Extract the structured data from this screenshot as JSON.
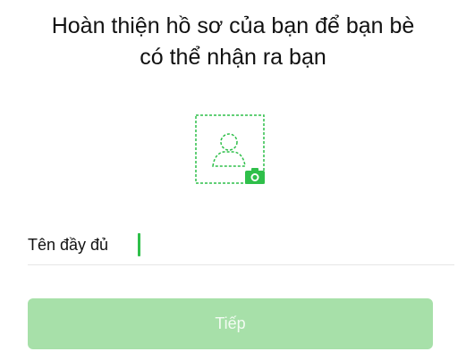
{
  "header": {
    "title_line1": "Hoàn thiện hồ sơ của bạn để bạn bè",
    "title_line2": "có thể nhận ra bạn"
  },
  "avatar": {
    "icon": "avatar-placeholder-icon",
    "badge_icon": "camera-icon",
    "accent_color": "#2fbf4a"
  },
  "form": {
    "full_name_label": "Tên đầy đủ",
    "full_name_value": ""
  },
  "actions": {
    "next_label": "Tiếp",
    "next_enabled": false,
    "button_color": "#a7e0a9"
  }
}
